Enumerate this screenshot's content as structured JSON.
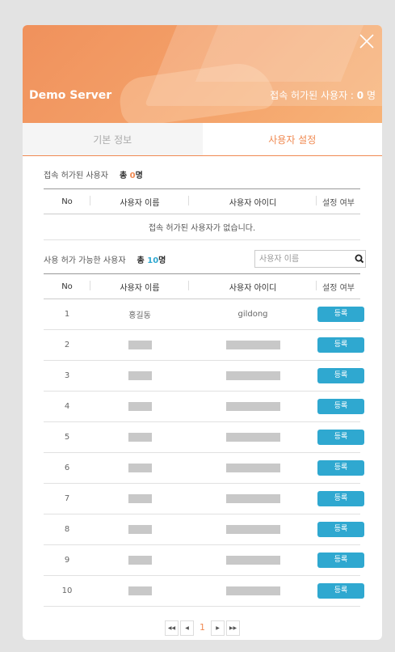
{
  "header": {
    "server_name": "Demo Server",
    "allowed_label": "접속 허가된 사용자 : ",
    "allowed_count": "0",
    "allowed_unit": " 명"
  },
  "tabs": [
    {
      "label": "기본 정보",
      "active": false
    },
    {
      "label": "사용자 설정",
      "active": true
    }
  ],
  "allowed_section": {
    "title": "접속 허가된 사용자",
    "total_prefix": "총 ",
    "total_count": "0",
    "total_unit": "명",
    "columns": [
      "No",
      "사용자 이름",
      "사용자 아이디",
      "설정 여부"
    ],
    "empty_message": "접속 허가된 사용자가 없습니다."
  },
  "available_section": {
    "title": "사용 허가 가능한 사용자",
    "total_prefix": "총 ",
    "total_count": "10",
    "total_unit": "명",
    "search_placeholder": "사용자 이름",
    "columns": [
      "No",
      "사용자 이름",
      "사용자 아이디",
      "설정 여부"
    ],
    "rows": [
      {
        "no": "1",
        "name": "홍길동",
        "id": "gildong",
        "action": "등록"
      },
      {
        "no": "2",
        "name": "",
        "id": "",
        "action": "등록"
      },
      {
        "no": "3",
        "name": "",
        "id": "",
        "action": "등록"
      },
      {
        "no": "4",
        "name": "",
        "id": "",
        "action": "등록"
      },
      {
        "no": "5",
        "name": "",
        "id": "",
        "action": "등록"
      },
      {
        "no": "6",
        "name": "",
        "id": "",
        "action": "등록"
      },
      {
        "no": "7",
        "name": "",
        "id": "",
        "action": "등록"
      },
      {
        "no": "8",
        "name": "",
        "id": "",
        "action": "등록"
      },
      {
        "no": "9",
        "name": "",
        "id": "",
        "action": "등록"
      },
      {
        "no": "10",
        "name": "",
        "id": "",
        "action": "등록"
      }
    ]
  },
  "pagination": {
    "first": "◀◀",
    "prev": "◀",
    "current": "1",
    "next": "▶",
    "last": "▶▶"
  },
  "colors": {
    "accent": "#f08a52",
    "button": "#2fa8d0"
  }
}
